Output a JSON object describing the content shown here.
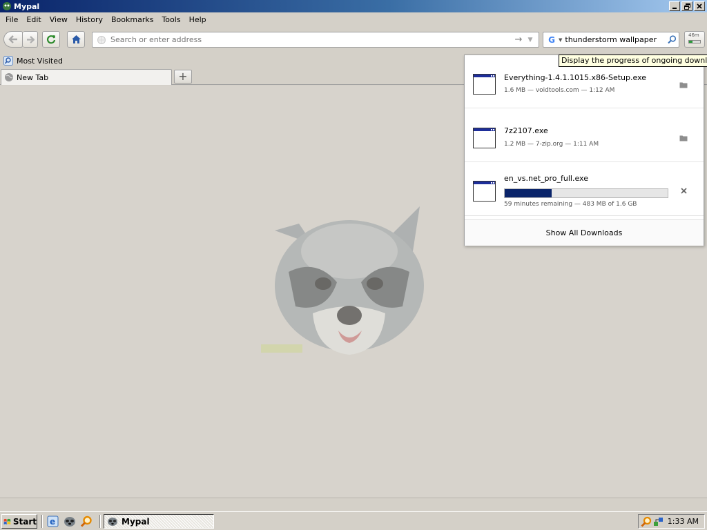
{
  "window": {
    "title": "Mypal"
  },
  "menu": [
    {
      "label": "File"
    },
    {
      "label": "Edit"
    },
    {
      "label": "View"
    },
    {
      "label": "History"
    },
    {
      "label": "Bookmarks"
    },
    {
      "label": "Tools"
    },
    {
      "label": "Help"
    }
  ],
  "address": {
    "placeholder": "Search or enter address"
  },
  "search": {
    "value": "thunderstorm wallpaper"
  },
  "download_button": {
    "label": "46m",
    "progress": 0.3
  },
  "tooltip": {
    "text": "Display the progress of ongoing downloads"
  },
  "bookmarks": {
    "most_visited": "Most Visited"
  },
  "tabs": [
    {
      "label": "New Tab"
    }
  ],
  "new_tab_symbol": "+",
  "downloads": {
    "items": [
      {
        "name": "Everything-1.4.1.1015.x86-Setup.exe",
        "meta": "1.6 MB — voidtools.com — 1:12 AM",
        "status": "complete"
      },
      {
        "name": "7z2107.exe",
        "meta": "1.2 MB — 7-zip.org — 1:11 AM",
        "status": "complete"
      },
      {
        "name": "en_vs.net_pro_full.exe",
        "meta": "59 minutes remaining — 483 MB of 1.6 GB",
        "status": "in_progress",
        "progress": 0.29
      }
    ],
    "show_all": "Show All Downloads"
  },
  "taskbar": {
    "start_label": "Start",
    "task_label": "Mypal",
    "clock": "1:33 AM"
  },
  "colors": {
    "progress_fill": "#0a246a",
    "title_gradient_start": "#0a246a",
    "tooltip_bg": "#ffffe1"
  },
  "icons": [
    "mypal-app-icon",
    "back-arrow-icon",
    "forward-arrow-icon",
    "reload-icon",
    "home-icon",
    "globe-icon",
    "go-arrow-icon",
    "dropdown-arrow-icon",
    "google-icon",
    "search-magnifier-icon",
    "downloads-icon",
    "most-visited-icon",
    "folder-icon",
    "cancel-icon",
    "windows-flag-icon"
  ]
}
